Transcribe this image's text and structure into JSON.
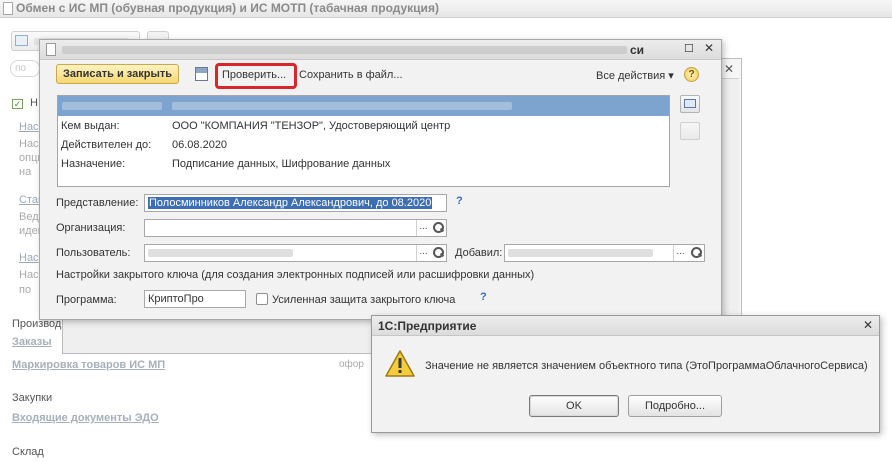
{
  "background": {
    "window_title": "Обмен с ИС МП (обувная продукция) и ИС МОТП (табачная продукция)",
    "search_placeholder": "Поиск",
    "section_mark": "Н",
    "links": [
      "Нас",
      "Стан",
      "Нас"
    ],
    "faded_lines": [
      "Нас",
      "опци",
      "на",
      "Веде",
      "иден",
      "Нас",
      "по"
    ],
    "group_production": "Производство",
    "link_orders": "Заказы",
    "link_marking": "Маркировка товаров ИС МП",
    "label_purchases": "Закупки",
    "link_incoming": "Входящие документы ЭДО",
    "label_warehouse": "Склад",
    "faded_right": "офор",
    "faded_title_right": "си"
  },
  "dialog": {
    "close_icon": "close-icon",
    "maximize_icon": "maximize-icon",
    "toolbar": {
      "save_close": "Записать и закрыть",
      "check": "Проверить...",
      "save_file": "Сохранить в файл...",
      "all_actions": "Все действия ▾",
      "help": "?"
    },
    "info": {
      "rows": [
        {
          "label": "Кем выдан:",
          "value": "ООО \"КОМПАНИЯ \"ТЕНЗОР\", Удостоверяющий центр"
        },
        {
          "label": "Действителен до:",
          "value": "06.08.2020"
        },
        {
          "label": "Назначение:",
          "value": "Подписание данных, Шифрование данных"
        }
      ]
    },
    "form": {
      "representation_label": "Представление:",
      "representation_value": "Полосминников Александр Александрович, до 08.2020",
      "organization_label": "Организация:",
      "user_label": "Пользователь:",
      "added_label": "Добавил:",
      "key_settings": "Настройки закрытого ключа (для создания электронных подписей или расшифровки данных)",
      "program_label": "Программа:",
      "program_value": "КриптоПро",
      "enhanced_protection": "Усиленная защита закрытого ключа",
      "help": "?",
      "ellipsis": "..."
    }
  },
  "message": {
    "title": "1С:Предприятие",
    "text": "Значение не является значением объектного типа (ЭтоПрограммаОблачногоСервиса)",
    "ok": "OK",
    "details": "Подробно...",
    "warning_icon": "warning-icon"
  },
  "colors": {
    "accent_red": "#d8262b",
    "selection_blue": "#3d6eb3",
    "strip_blue": "#7da3cf",
    "button_yellow": "#f5d873"
  }
}
